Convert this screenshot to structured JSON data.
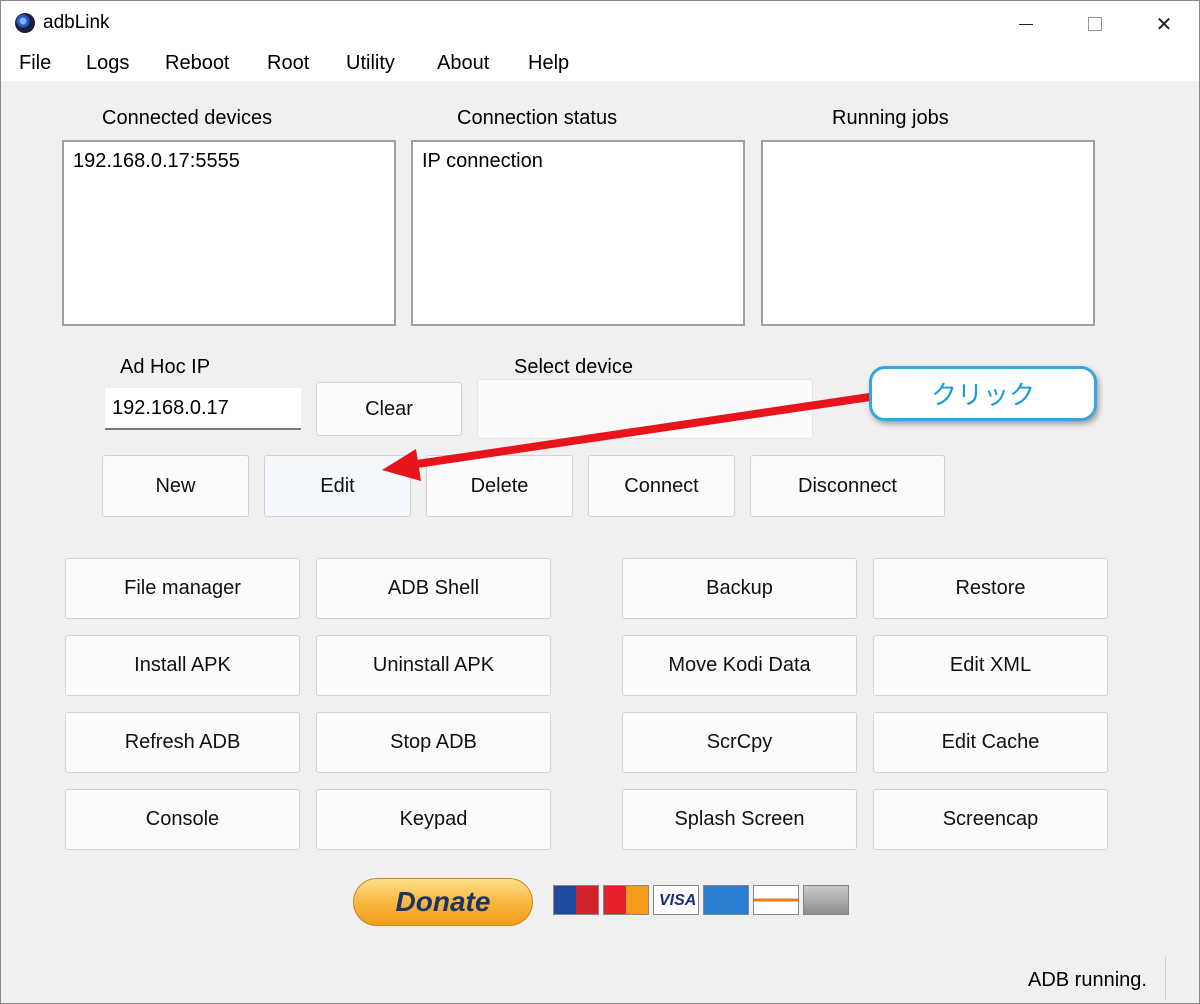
{
  "window": {
    "title": "adbLink",
    "app_icon": "adblink-logo-icon"
  },
  "menu": [
    "File",
    "Logs",
    "Reboot",
    "Root",
    "Utility",
    "About",
    "Help"
  ],
  "panels": {
    "connected_devices": {
      "label": "Connected devices",
      "items": [
        "192.168.0.17:5555"
      ]
    },
    "connection_status": {
      "label": "Connection status",
      "items": [
        "IP connection"
      ]
    },
    "running_jobs": {
      "label": "Running jobs",
      "items": []
    }
  },
  "adhoc": {
    "label": "Ad Hoc IP",
    "value": "192.168.0.17",
    "clear_label": "Clear"
  },
  "select_device": {
    "label": "Select device",
    "value": ""
  },
  "device_buttons": [
    "New",
    "Edit",
    "Delete",
    "Connect",
    "Disconnect"
  ],
  "action_buttons": {
    "col1": [
      "File manager",
      "Install APK",
      "Refresh ADB",
      "Console"
    ],
    "col2": [
      "ADB Shell",
      "Uninstall APK",
      "Stop ADB",
      "Keypad"
    ],
    "col3": [
      "Backup",
      "Move Kodi Data",
      "ScrCpy",
      "Splash Screen"
    ],
    "col4": [
      "Restore",
      "Edit XML",
      "Edit Cache",
      "Screencap"
    ]
  },
  "annotation": {
    "text": "クリック",
    "arrow_color": "#e8141c",
    "callout_border": "#37a6d8"
  },
  "donate": {
    "label": "Donate"
  },
  "status_bar": {
    "text": "ADB running."
  }
}
